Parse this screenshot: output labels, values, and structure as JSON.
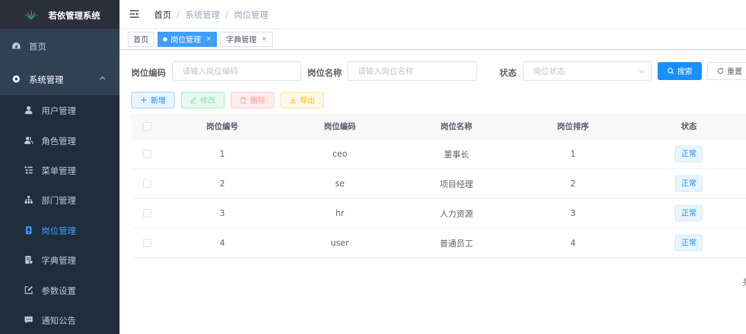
{
  "app": {
    "title": "若依管理系统"
  },
  "sidebar": {
    "home": "首页",
    "group": "系统管理",
    "items": [
      {
        "label": "用户管理",
        "icon": "user-icon"
      },
      {
        "label": "角色管理",
        "icon": "peoples-icon"
      },
      {
        "label": "菜单管理",
        "icon": "tree-table-icon"
      },
      {
        "label": "部门管理",
        "icon": "tree-icon"
      },
      {
        "label": "岗位管理",
        "icon": "post-icon",
        "active": true
      },
      {
        "label": "字典管理",
        "icon": "dict-icon"
      },
      {
        "label": "参数设置",
        "icon": "edit-icon"
      },
      {
        "label": "通知公告",
        "icon": "message-icon"
      }
    ]
  },
  "breadcrumb": [
    "首页",
    "系统管理",
    "岗位管理"
  ],
  "tags": [
    {
      "label": "首页",
      "active": false
    },
    {
      "label": "岗位管理",
      "active": true,
      "close": "×"
    },
    {
      "label": "字典管理",
      "active": false,
      "close": "×"
    }
  ],
  "search": {
    "code_label": "岗位编码",
    "code_placeholder": "请输入岗位编码",
    "name_label": "岗位名称",
    "name_placeholder": "请输入岗位名称",
    "status_label": "状态",
    "status_placeholder": "岗位状态",
    "search_button": "搜索",
    "reset_button": "重置"
  },
  "toolbar": {
    "add": "新增",
    "edit": "修改",
    "delete": "删除",
    "export": "导出"
  },
  "table": {
    "columns": [
      "岗位编号",
      "岗位编码",
      "岗位名称",
      "岗位排序",
      "状态"
    ],
    "rows": [
      {
        "id": "1",
        "code": "ceo",
        "name": "董事长",
        "sort": "1",
        "status": "正常"
      },
      {
        "id": "2",
        "code": "se",
        "name": "项目经理",
        "sort": "2",
        "status": "正常"
      },
      {
        "id": "3",
        "code": "hr",
        "name": "人力资源",
        "sort": "3",
        "status": "正常"
      },
      {
        "id": "4",
        "code": "user",
        "name": "普通员工",
        "sort": "4",
        "status": "正常"
      }
    ]
  },
  "pagination": {
    "fragment": "共"
  },
  "colors": {
    "sidebar_bg": "#304156",
    "submenu_bg": "#1f2d3d",
    "active": "#409eff",
    "primary": "#1890ff"
  }
}
